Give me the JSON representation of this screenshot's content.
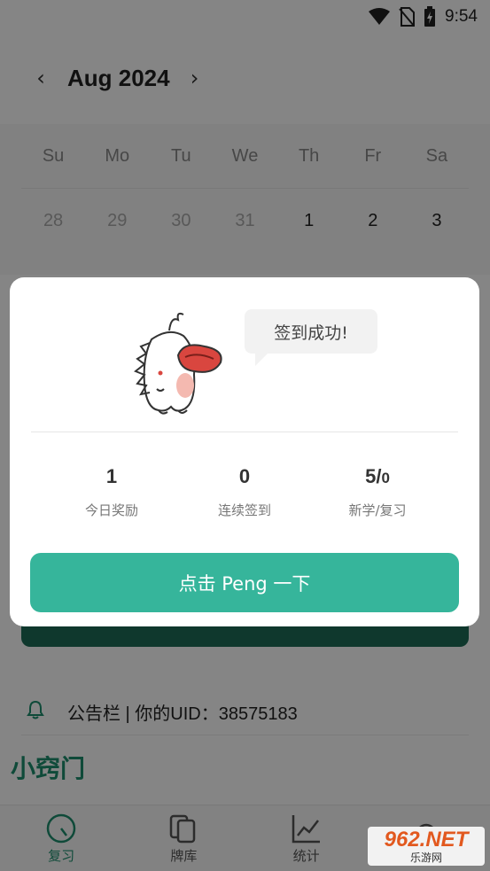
{
  "statusbar": {
    "time": "9:54"
  },
  "calendar": {
    "month_label": "Aug 2024",
    "weekdays": [
      "Su",
      "Mo",
      "Tu",
      "We",
      "Th",
      "Fr",
      "Sa"
    ],
    "first_week": [
      "28",
      "29",
      "30",
      "31",
      "1",
      "2",
      "3"
    ]
  },
  "notice": {
    "text": "公告栏 | 你的UID：38575183"
  },
  "section": {
    "title": "小窍门"
  },
  "tabs": [
    {
      "label": "复习",
      "icon": "timer-icon"
    },
    {
      "label": "牌库",
      "icon": "cards-icon"
    },
    {
      "label": "统计",
      "icon": "chart-icon"
    },
    {
      "label": "",
      "icon": "search-icon"
    }
  ],
  "watermark": {
    "brand": "962.NET",
    "caption": "乐游网"
  },
  "dialog": {
    "bubble_text": "签到成功!",
    "stats": [
      {
        "value": "1",
        "label": "今日奖励"
      },
      {
        "value": "0",
        "label": "连续签到"
      },
      {
        "value_main": "5/",
        "value_small": "0",
        "label": "新学/复习"
      }
    ],
    "cta_label": "点击 Peng 一下"
  },
  "colors": {
    "accent": "#36b59b",
    "brand_dark": "#1d8f6e",
    "overlay": "rgba(0,0,0,0.48)"
  }
}
